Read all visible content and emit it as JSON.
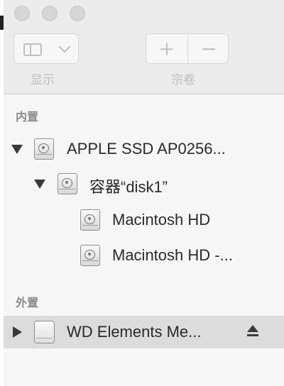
{
  "toolbar": {
    "view_label": "显示",
    "volume_label": "宗卷",
    "add_glyph": "+",
    "remove_glyph": "−"
  },
  "sidebar": {
    "internal_header": "内置",
    "external_header": "外置",
    "internal_items": [
      {
        "label": "APPLE SSD AP0256...",
        "level": 0,
        "expanded": true,
        "icon": "internal-disk-icon"
      },
      {
        "label": "容器“disk1”",
        "level": 1,
        "expanded": true,
        "icon": "internal-disk-icon"
      },
      {
        "label": "Macintosh HD",
        "level": 2,
        "icon": "internal-disk-icon"
      },
      {
        "label": "Macintosh HD -...",
        "level": 2,
        "icon": "internal-disk-icon"
      }
    ],
    "external_items": [
      {
        "label": "WD Elements Me...",
        "level": 0,
        "expanded": false,
        "selected": true,
        "icon": "external-disk-icon",
        "eject": "eject-icon"
      }
    ]
  }
}
